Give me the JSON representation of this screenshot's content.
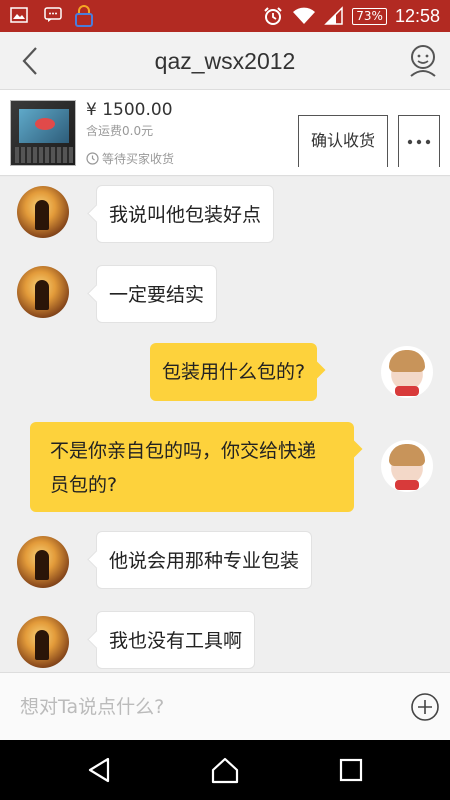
{
  "status_bar": {
    "battery": "73%",
    "time": "12:58"
  },
  "header": {
    "title": "qaz_wsx2012"
  },
  "product": {
    "price": "¥ 1500.00",
    "shipping": "含运费0.0元",
    "status": "等待买家收货",
    "confirm_label": "确认收货"
  },
  "messages": [
    {
      "side": "left",
      "text": "我说叫他包装好点"
    },
    {
      "side": "left",
      "text": "一定要结实"
    },
    {
      "side": "right",
      "text": "包装用什么包的?"
    },
    {
      "side": "right",
      "text": "不是你亲自包的吗，你交给快递员包的?"
    },
    {
      "side": "left",
      "text": "他说会用那种专业包装"
    },
    {
      "side": "left",
      "text": "我也没有工具啊"
    }
  ],
  "input": {
    "placeholder": "想对Ta说点什么?"
  },
  "colors": {
    "status_bar": "#b22a22",
    "bubble_self": "#fdd23c",
    "bubble_other": "#ffffff"
  }
}
